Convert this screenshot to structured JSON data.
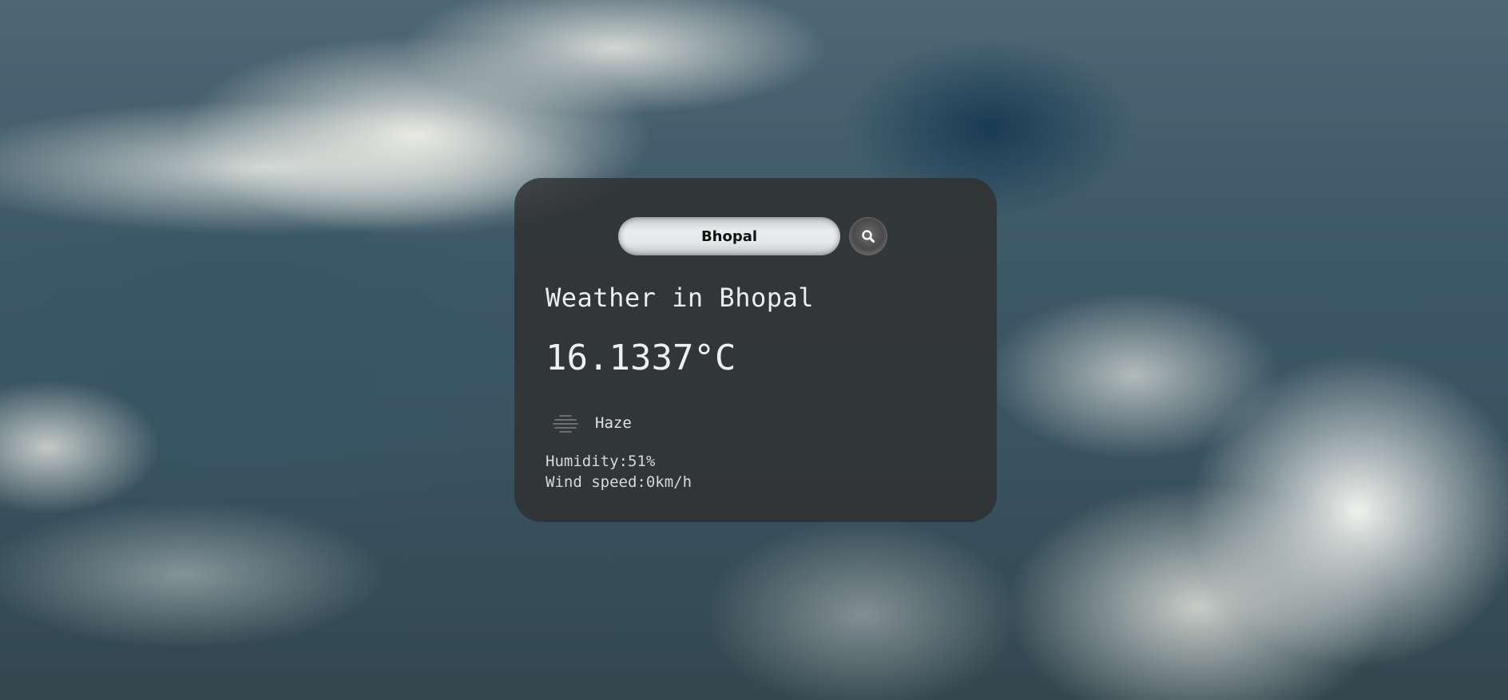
{
  "search": {
    "value": "Bhopal",
    "button_icon": "search-icon"
  },
  "weather": {
    "title": "Weather in Bhopal",
    "temperature": "16.1337°C",
    "condition_icon": "haze-icon",
    "condition": "Haze",
    "humidity": "Humidity:51%",
    "wind_speed": "Wind speed:0km/h"
  },
  "colors": {
    "card_background": "#303030",
    "search_field": "#e6e9ea",
    "text": "#ececec"
  }
}
